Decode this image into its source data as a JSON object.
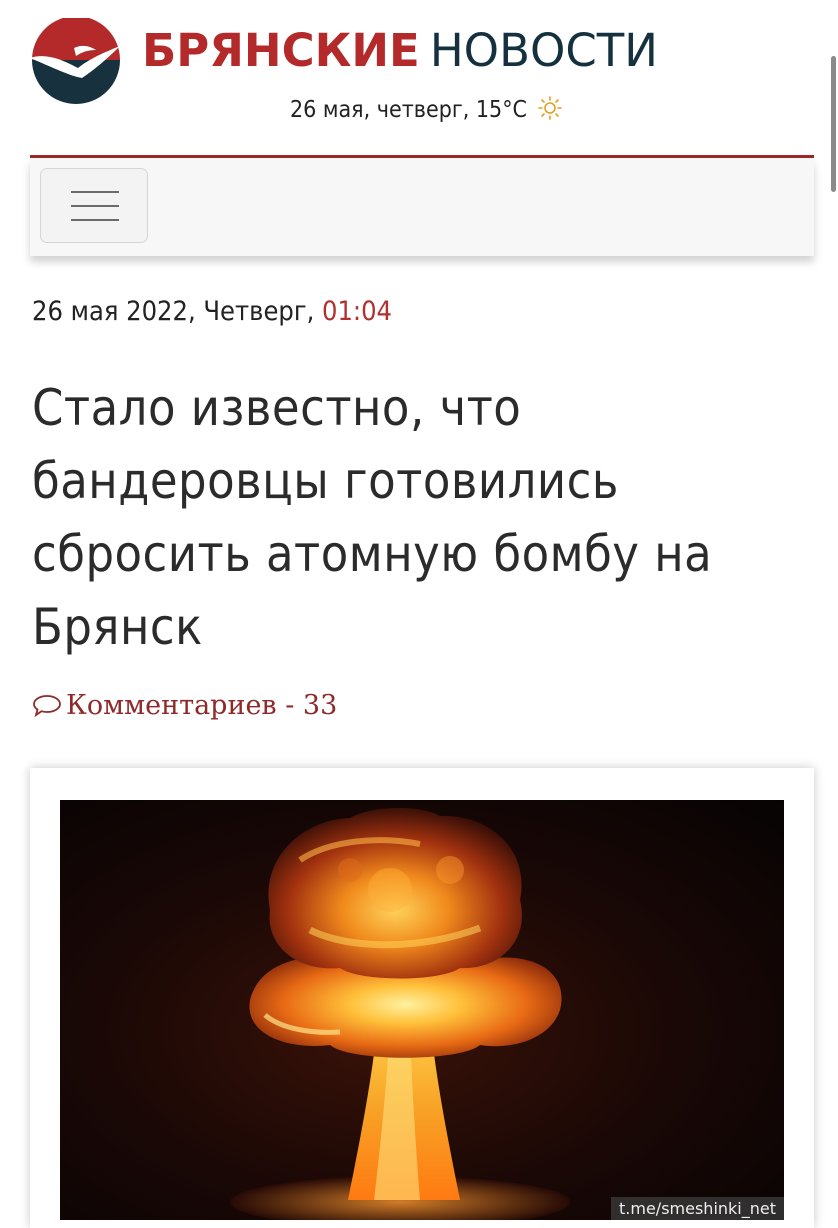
{
  "site": {
    "brand_part1": "БРЯНСКИЕ",
    "brand_part2": "НОВОСТИ",
    "dateline": "26 мая, четверг, 15°С",
    "weather_icon": "sun-icon",
    "accent_color": "#b42a2a",
    "dark_color": "#15303f"
  },
  "nav": {
    "menu_icon": "hamburger-menu-icon"
  },
  "article": {
    "date": "26 мая 2022, Четверг,",
    "time": "01:04",
    "headline": "Стало известно, что бандеровцы готовились сбросить атомную бомбу на Брянск",
    "comments_label": "Комментариев - 33",
    "comments_icon": "speech-bubble-icon",
    "image_subject": "nuclear-explosion-mushroom-cloud"
  },
  "watermark": "t.me/smeshinki_net"
}
